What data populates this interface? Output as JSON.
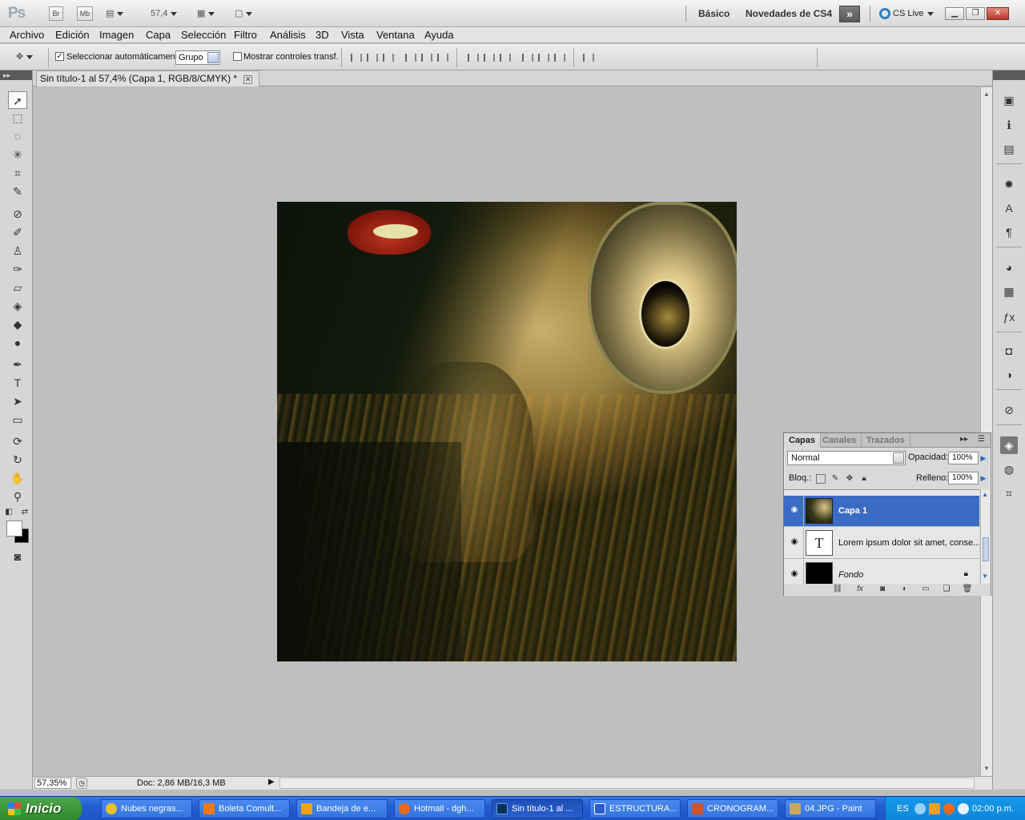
{
  "app": {
    "logo": "Ps",
    "bridge_btn": "Br",
    "mini_bridge_btn": "Mb",
    "zoom_display": "57,4",
    "workspace_basic": "Básico",
    "workspace_new": "Novedades de CS4",
    "cs_live": "CS Live"
  },
  "menu": [
    "Archivo",
    "Edición",
    "Imagen",
    "Capa",
    "Selección",
    "Filtro",
    "Análisis",
    "3D",
    "Vista",
    "Ventana",
    "Ayuda"
  ],
  "options": {
    "auto_select_label": "Seleccionar automáticamente:",
    "auto_select_checked": true,
    "auto_select_value": "Grupo",
    "transform_label": "Mostrar controles transf.",
    "transform_checked": false
  },
  "document": {
    "tab_title": "Sin título-1 al 57,4% (Capa 1, RGB/8/CMYK) *"
  },
  "status": {
    "zoom": "57,35%",
    "doc_info": "Doc: 2,86 MB/16,3 MB"
  },
  "layers_panel": {
    "tabs": [
      "Capas",
      "Canales",
      "Trazados"
    ],
    "active_tab": "Capas",
    "blend_mode": "Normal",
    "opacity_label": "Opacidad:",
    "opacity_value": "100%",
    "lock_label": "Bloq.:",
    "fill_label": "Relleno:",
    "fill_value": "100%",
    "layers": [
      {
        "name": "Capa 1",
        "selected": true,
        "thumb": "photo"
      },
      {
        "name": "Lorem ipsum dolor sit amet, conse...",
        "selected": false,
        "thumb": "T"
      },
      {
        "name": "Fondo",
        "selected": false,
        "thumb": "black",
        "locked": true
      }
    ]
  },
  "taskbar": {
    "start": "Inicio",
    "tasks": [
      {
        "label": "Nubes negras...",
        "icon_color": "#e7c12b"
      },
      {
        "label": "Boleta Comult...",
        "icon_color": "#f07a1a"
      },
      {
        "label": "Bandeja de e...",
        "icon_color": "#f0a21a"
      },
      {
        "label": "Hotmail - dgh...",
        "icon_color": "#e86a1e"
      },
      {
        "label": "Sin título-1 al ...",
        "icon_color": "#0b2f5c",
        "active": true
      },
      {
        "label": "ESTRUCTURA...",
        "icon_color": "#2a5bd0"
      },
      {
        "label": "CRONOGRAM...",
        "icon_color": "#d0542a"
      },
      {
        "label": "04.JPG - Paint",
        "icon_color": "#c7a85a"
      }
    ],
    "language": "ES",
    "clock": "02:00 p.m."
  }
}
